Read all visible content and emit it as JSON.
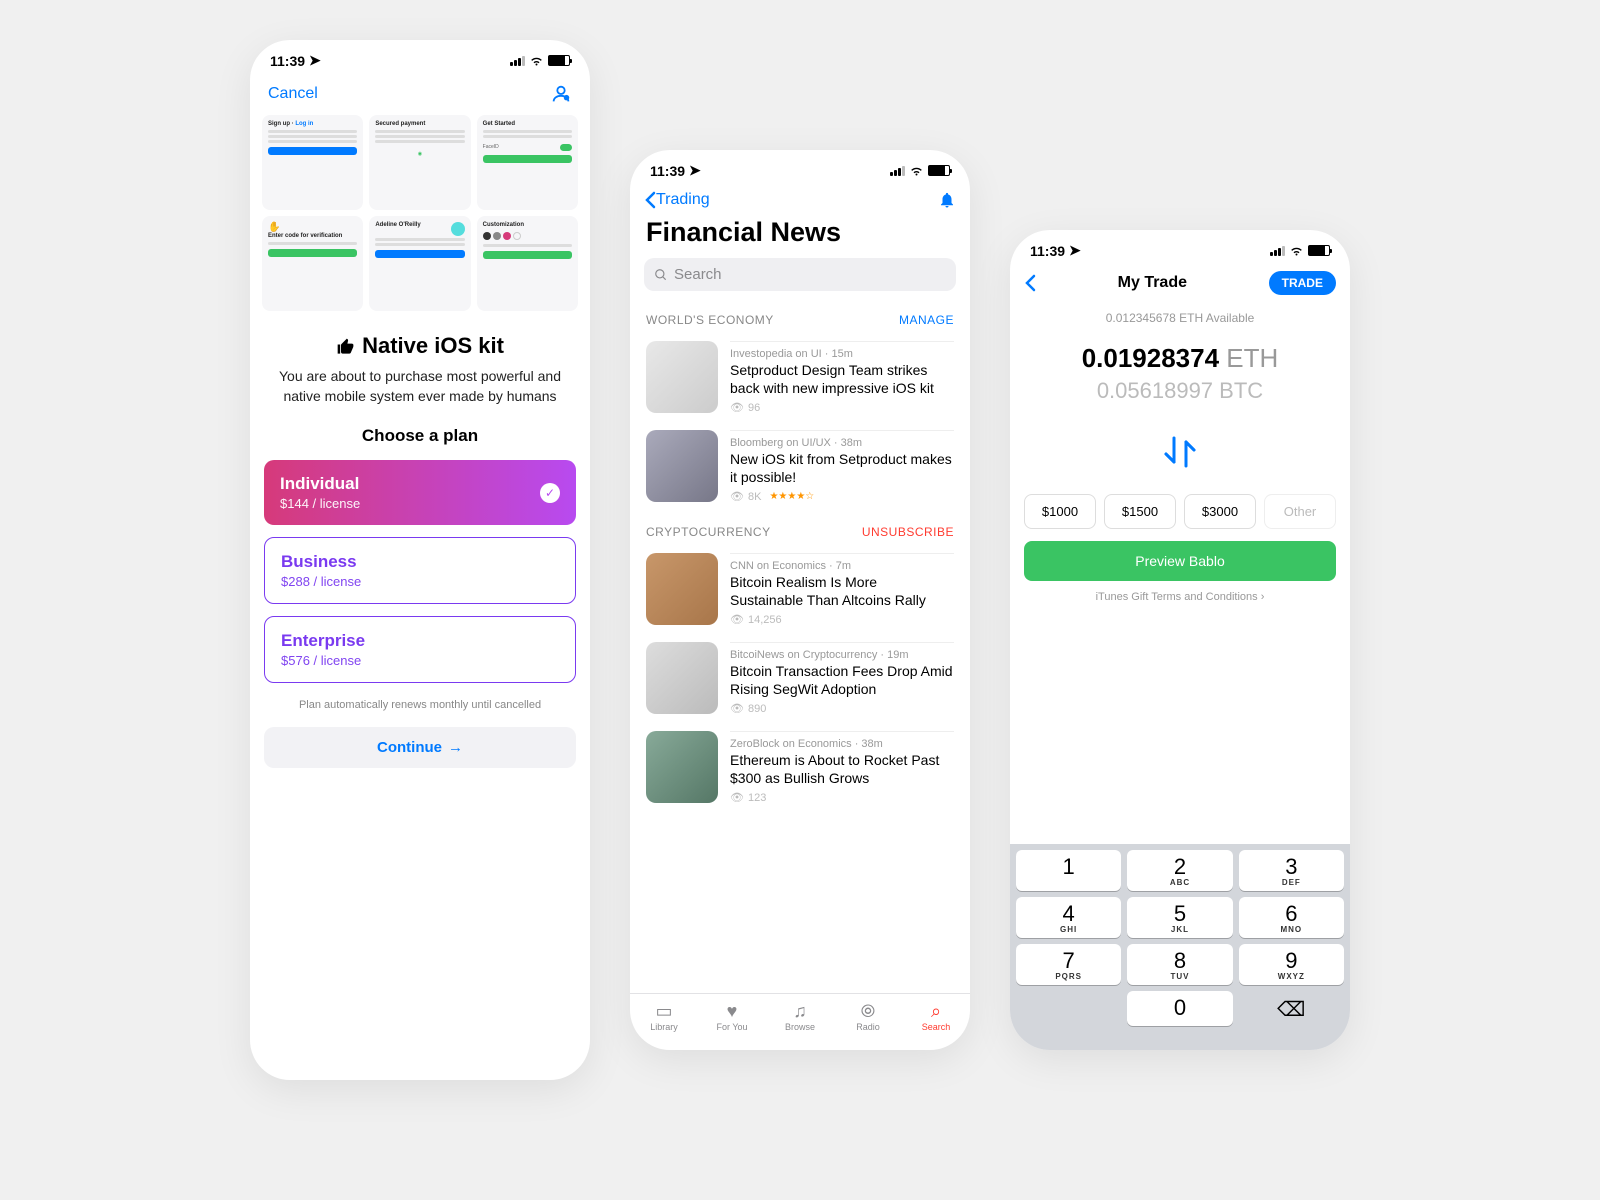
{
  "statusbar": {
    "time": "11:39"
  },
  "phone1": {
    "cancel": "Cancel",
    "previews": [
      {
        "title": "Sign up",
        "link": "Log in"
      },
      {
        "title": "Secured payment"
      },
      {
        "title": "Get Started"
      },
      {
        "title": "Enter code for verification"
      },
      {
        "title": "Adeline O'Reilly"
      },
      {
        "title": "Customization"
      }
    ],
    "heading": "Native iOS kit",
    "desc": "You are about to purchase most powerful and native mobile system ever made by humans",
    "choose": "Choose a plan",
    "plans": [
      {
        "name": "Individual",
        "price": "$144 / license"
      },
      {
        "name": "Business",
        "price": "$288 / license"
      },
      {
        "name": "Enterprise",
        "price": "$576 / license"
      }
    ],
    "renew": "Plan automatically renews monthly until cancelled",
    "continue": "Continue"
  },
  "phone2": {
    "back": "Trading",
    "title": "Financial News",
    "search_placeholder": "Search",
    "sections": [
      {
        "label": "WORLD'S ECONOMY",
        "action": "MANAGE",
        "items": [
          {
            "meta": "Investopedia on UI · 15m",
            "headline": "Setproduct Design Team strikes back with new impressive iOS kit",
            "views": "96"
          },
          {
            "meta": "Bloomberg on UI/UX · 38m",
            "headline": "New iOS kit from Setproduct makes it possible!",
            "views": "8K",
            "stars": "★★★★☆"
          }
        ]
      },
      {
        "label": "CRYPTOCURRENCY",
        "action": "UNSUBSCRIBE",
        "items": [
          {
            "meta": "CNN on Economics · 7m",
            "headline": "Bitcoin Realism Is More Sustainable Than Altcoins Rally",
            "views": "14,256"
          },
          {
            "meta": "BitcoiNews on Cryptocurrency · 19m",
            "headline": "Bitcoin Transaction Fees Drop Amid Rising SegWit Adoption",
            "views": "890"
          },
          {
            "meta": "ZeroBlock on Economics · 38m",
            "headline": "Ethereum is About to Rocket Past $300 as Bullish Grows",
            "views": "123"
          }
        ]
      }
    ],
    "tabs": [
      {
        "label": "Library",
        "icon": "▭"
      },
      {
        "label": "For You",
        "icon": "♥"
      },
      {
        "label": "Browse",
        "icon": "♫"
      },
      {
        "label": "Radio",
        "icon": "⦾"
      },
      {
        "label": "Search",
        "icon": "⌕"
      }
    ]
  },
  "phone3": {
    "title": "My Trade",
    "trade": "TRADE",
    "available": "0.012345678 ETH Available",
    "primary_num": "0.01928374",
    "primary_cur": "ETH",
    "secondary_num": "0.05618997",
    "secondary_cur": "BTC",
    "chips": [
      "$1000",
      "$1500",
      "$3000",
      "Other"
    ],
    "preview": "Preview Bablo",
    "terms": "iTunes Gift Terms and Conditions",
    "keys": [
      [
        "1",
        ""
      ],
      [
        "2",
        "ABC"
      ],
      [
        "3",
        "DEF"
      ],
      [
        "4",
        "GHI"
      ],
      [
        "5",
        "JKL"
      ],
      [
        "6",
        "MNO"
      ],
      [
        "7",
        "PQRS"
      ],
      [
        "8",
        "TUV"
      ],
      [
        "9",
        "WXYZ"
      ],
      [
        "",
        "blank"
      ],
      [
        "0",
        ""
      ],
      [
        "⌫",
        "del"
      ]
    ]
  }
}
